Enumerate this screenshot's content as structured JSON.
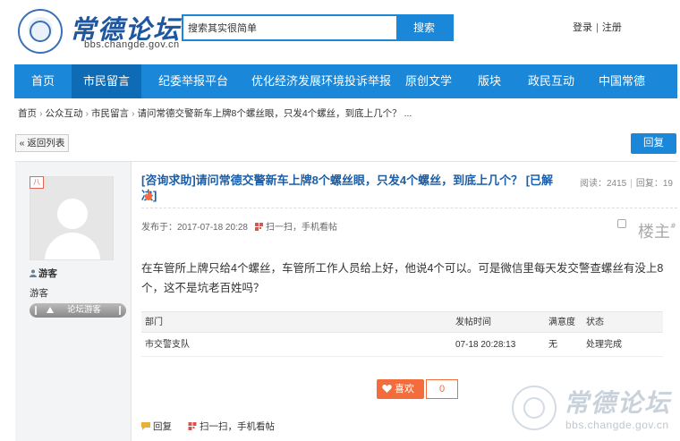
{
  "header": {
    "logo_title": "常德论坛",
    "logo_url": "bbs.changde.gov.cn",
    "logo_seal_text": "常德论坛 bbs.changde.gov.cn",
    "search_value": "搜索其实很简单",
    "search_button": "搜索",
    "login": "登录",
    "register": "注册",
    "auth_sep": "|"
  },
  "nav": {
    "items": [
      {
        "label": "首页"
      },
      {
        "label": "市民留言"
      },
      {
        "label": "纪委举报平台"
      },
      {
        "label": "优化经济发展环境投诉举报"
      },
      {
        "label": "原创文学"
      },
      {
        "label": "版块"
      },
      {
        "label": "政民互动"
      },
      {
        "label": "中国常德"
      }
    ],
    "active_index": 1
  },
  "breadcrumb": {
    "items": [
      "首页",
      "公众互动",
      "市民留言",
      "请问常德交警新车上牌8个螺丝眼，只发4个螺丝，到底上几个？ ..."
    ],
    "sep": "›"
  },
  "actions": {
    "back_label": "« 返回列表",
    "reply_label": "回复"
  },
  "user": {
    "badge": "八",
    "name": "游客",
    "group": "游客",
    "level": "论坛游客"
  },
  "post": {
    "title": "[咨询求助]请问常德交警新车上牌8个螺丝眼，只发4个螺丝，到底上几个？ [已解决]",
    "views_label": "阅读：2415",
    "replies_label": "回复：19",
    "views_sep": "|",
    "published": "发布于：2017-07-18 20:28",
    "scan": "扫一扫，手机看帖",
    "floor": "楼主",
    "floor_mark": "#",
    "body": "在车管所上牌只给4个螺丝，车管所工作人员给上好，他说4个可以。可是微信里每天发交警查螺丝有没上8个，这不是坑老百姓吗？"
  },
  "feedback": {
    "headers": [
      "部门",
      "发帖时间",
      "满意度",
      "状态"
    ],
    "rows": [
      {
        "dept": "市交警支队",
        "time": "07-18 20:28:13",
        "satisfaction": "无",
        "status": "处理完成"
      }
    ]
  },
  "like": {
    "label": "喜欢",
    "count": "0"
  },
  "footer": {
    "reply": "回复",
    "scan": "扫一扫，手机看帖"
  },
  "watermark": {
    "title": "常德论坛",
    "url": "bbs.changde.gov.cn",
    "seal_text": "常德论坛 bbs.changde.gov.cn"
  },
  "colors": {
    "brand_blue": "#1a87d8",
    "title_blue": "#1b5ea8",
    "like_orange": "#f46c3b"
  }
}
